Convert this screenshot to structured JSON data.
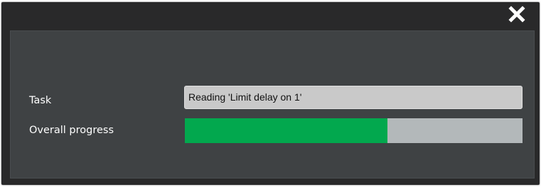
{
  "dialog": {
    "close_icon": "close-icon",
    "task_label": "Task",
    "task_value": "Reading 'Limit delay on 1'",
    "progress_label": "Overall progress",
    "progress_fraction": 0.6,
    "colors": {
      "progress_fill": "#02a84e",
      "background": "#3f4244",
      "titlebar": "#29292a"
    }
  }
}
